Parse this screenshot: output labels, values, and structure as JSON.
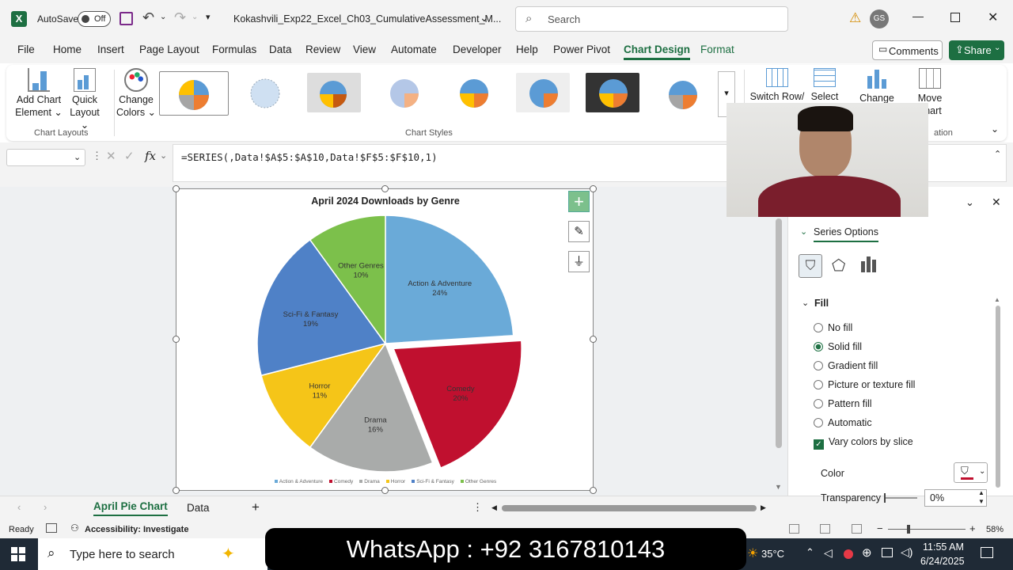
{
  "titlebar": {
    "autosave_label": "AutoSave",
    "autosave_state": "Off",
    "filename": "Kokashvili_Exp22_Excel_Ch03_CumulativeAssessment_M...",
    "search_placeholder": "Search",
    "user_initials": "GS"
  },
  "tabs": [
    "File",
    "Home",
    "Insert",
    "Page Layout",
    "Formulas",
    "Data",
    "Review",
    "View",
    "Automate",
    "Developer",
    "Help",
    "Power Pivot",
    "Chart Design",
    "Format"
  ],
  "comments_label": "Comments",
  "share_label": "Share",
  "ribbon": {
    "add_chart_element": [
      "Add Chart",
      "Element"
    ],
    "quick_layout": [
      "Quick",
      "Layout"
    ],
    "chart_layouts_label": "Chart Layouts",
    "change_colors": [
      "Change",
      "Colors"
    ],
    "chart_styles_label": "Chart Styles",
    "switch_row": "Switch Row/",
    "select": "Select",
    "change": "Change",
    "move": [
      "Move",
      "hart"
    ],
    "location_fragment": "ation"
  },
  "formula_bar": {
    "fx": "fx",
    "formula": "=SERIES(,Data!$A$5:$A$10,Data!$F$5:$F$10,1)"
  },
  "chart_data": {
    "type": "pie",
    "title": "April 2024 Downloads by Genre",
    "categories": [
      "Action & Adventure",
      "Comedy",
      "Drama",
      "Horror",
      "Sci-Fi & Fantasy",
      "Other Genres"
    ],
    "values": [
      24,
      20,
      16,
      11,
      19,
      10
    ],
    "labels": [
      "24%",
      "20%",
      "16%",
      "11%",
      "19%",
      "10%"
    ],
    "colors": [
      "#6aaad8",
      "#c0102f",
      "#a9abaa",
      "#f5c518",
      "#4f81c7",
      "#7cc04b"
    ],
    "exploded": "Comedy",
    "legend_position": "bottom"
  },
  "format_pane": {
    "section": "Series Options",
    "fill_heading": "Fill",
    "options": [
      "No fill",
      "Solid fill",
      "Gradient fill",
      "Picture or texture fill",
      "Pattern fill",
      "Automatic"
    ],
    "selected": "Solid fill",
    "vary_colors": "Vary colors by slice",
    "color_label": "Color",
    "transparency_label": "Transparency",
    "transparency_value": "0%"
  },
  "sheet_tabs": [
    "April Pie Chart",
    "Data"
  ],
  "status": {
    "ready": "Ready",
    "accessibility": "Accessibility: Investigate",
    "zoom": "58%"
  },
  "taskbar": {
    "search_placeholder": "Type here to search",
    "banner": "WhatsApp : +92 3167810143",
    "temp": "35°C",
    "time": "11:55 AM",
    "date": "6/24/2025"
  }
}
